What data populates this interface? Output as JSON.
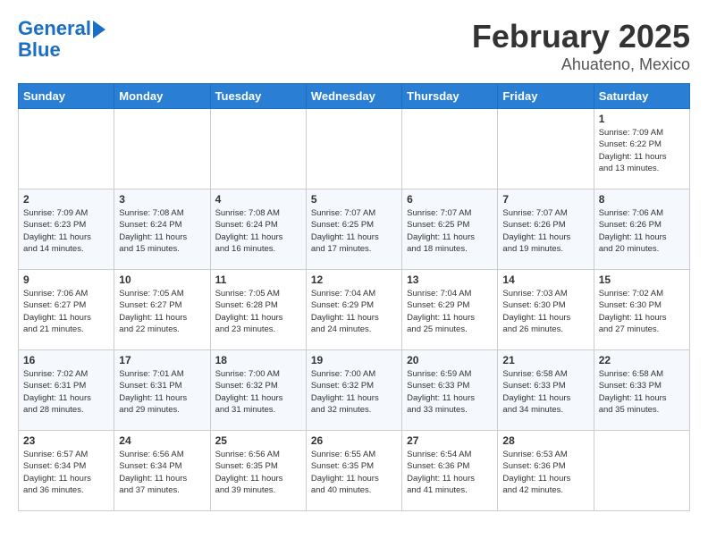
{
  "header": {
    "logo_line1": "General",
    "logo_line2": "Blue",
    "title": "February 2025",
    "subtitle": "Ahuateno, Mexico"
  },
  "days_of_week": [
    "Sunday",
    "Monday",
    "Tuesday",
    "Wednesday",
    "Thursday",
    "Friday",
    "Saturday"
  ],
  "weeks": [
    [
      {
        "day": "",
        "info": ""
      },
      {
        "day": "",
        "info": ""
      },
      {
        "day": "",
        "info": ""
      },
      {
        "day": "",
        "info": ""
      },
      {
        "day": "",
        "info": ""
      },
      {
        "day": "",
        "info": ""
      },
      {
        "day": "1",
        "info": "Sunrise: 7:09 AM\nSunset: 6:22 PM\nDaylight: 11 hours\nand 13 minutes."
      }
    ],
    [
      {
        "day": "2",
        "info": "Sunrise: 7:09 AM\nSunset: 6:23 PM\nDaylight: 11 hours\nand 14 minutes."
      },
      {
        "day": "3",
        "info": "Sunrise: 7:08 AM\nSunset: 6:24 PM\nDaylight: 11 hours\nand 15 minutes."
      },
      {
        "day": "4",
        "info": "Sunrise: 7:08 AM\nSunset: 6:24 PM\nDaylight: 11 hours\nand 16 minutes."
      },
      {
        "day": "5",
        "info": "Sunrise: 7:07 AM\nSunset: 6:25 PM\nDaylight: 11 hours\nand 17 minutes."
      },
      {
        "day": "6",
        "info": "Sunrise: 7:07 AM\nSunset: 6:25 PM\nDaylight: 11 hours\nand 18 minutes."
      },
      {
        "day": "7",
        "info": "Sunrise: 7:07 AM\nSunset: 6:26 PM\nDaylight: 11 hours\nand 19 minutes."
      },
      {
        "day": "8",
        "info": "Sunrise: 7:06 AM\nSunset: 6:26 PM\nDaylight: 11 hours\nand 20 minutes."
      }
    ],
    [
      {
        "day": "9",
        "info": "Sunrise: 7:06 AM\nSunset: 6:27 PM\nDaylight: 11 hours\nand 21 minutes."
      },
      {
        "day": "10",
        "info": "Sunrise: 7:05 AM\nSunset: 6:27 PM\nDaylight: 11 hours\nand 22 minutes."
      },
      {
        "day": "11",
        "info": "Sunrise: 7:05 AM\nSunset: 6:28 PM\nDaylight: 11 hours\nand 23 minutes."
      },
      {
        "day": "12",
        "info": "Sunrise: 7:04 AM\nSunset: 6:29 PM\nDaylight: 11 hours\nand 24 minutes."
      },
      {
        "day": "13",
        "info": "Sunrise: 7:04 AM\nSunset: 6:29 PM\nDaylight: 11 hours\nand 25 minutes."
      },
      {
        "day": "14",
        "info": "Sunrise: 7:03 AM\nSunset: 6:30 PM\nDaylight: 11 hours\nand 26 minutes."
      },
      {
        "day": "15",
        "info": "Sunrise: 7:02 AM\nSunset: 6:30 PM\nDaylight: 11 hours\nand 27 minutes."
      }
    ],
    [
      {
        "day": "16",
        "info": "Sunrise: 7:02 AM\nSunset: 6:31 PM\nDaylight: 11 hours\nand 28 minutes."
      },
      {
        "day": "17",
        "info": "Sunrise: 7:01 AM\nSunset: 6:31 PM\nDaylight: 11 hours\nand 29 minutes."
      },
      {
        "day": "18",
        "info": "Sunrise: 7:00 AM\nSunset: 6:32 PM\nDaylight: 11 hours\nand 31 minutes."
      },
      {
        "day": "19",
        "info": "Sunrise: 7:00 AM\nSunset: 6:32 PM\nDaylight: 11 hours\nand 32 minutes."
      },
      {
        "day": "20",
        "info": "Sunrise: 6:59 AM\nSunset: 6:33 PM\nDaylight: 11 hours\nand 33 minutes."
      },
      {
        "day": "21",
        "info": "Sunrise: 6:58 AM\nSunset: 6:33 PM\nDaylight: 11 hours\nand 34 minutes."
      },
      {
        "day": "22",
        "info": "Sunrise: 6:58 AM\nSunset: 6:33 PM\nDaylight: 11 hours\nand 35 minutes."
      }
    ],
    [
      {
        "day": "23",
        "info": "Sunrise: 6:57 AM\nSunset: 6:34 PM\nDaylight: 11 hours\nand 36 minutes."
      },
      {
        "day": "24",
        "info": "Sunrise: 6:56 AM\nSunset: 6:34 PM\nDaylight: 11 hours\nand 37 minutes."
      },
      {
        "day": "25",
        "info": "Sunrise: 6:56 AM\nSunset: 6:35 PM\nDaylight: 11 hours\nand 39 minutes."
      },
      {
        "day": "26",
        "info": "Sunrise: 6:55 AM\nSunset: 6:35 PM\nDaylight: 11 hours\nand 40 minutes."
      },
      {
        "day": "27",
        "info": "Sunrise: 6:54 AM\nSunset: 6:36 PM\nDaylight: 11 hours\nand 41 minutes."
      },
      {
        "day": "28",
        "info": "Sunrise: 6:53 AM\nSunset: 6:36 PM\nDaylight: 11 hours\nand 42 minutes."
      },
      {
        "day": "",
        "info": ""
      }
    ]
  ]
}
